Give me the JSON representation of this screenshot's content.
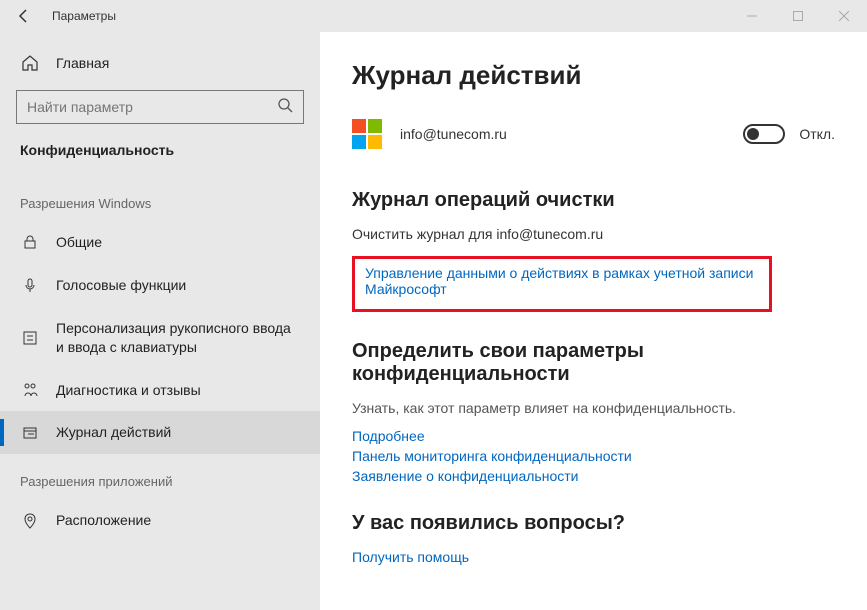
{
  "titlebar": {
    "title": "Параметры"
  },
  "sidebar": {
    "home": "Главная",
    "search_placeholder": "Найти параметр",
    "category": "Конфиденциальность",
    "group1": "Разрешения Windows",
    "items1": [
      {
        "label": "Общие"
      },
      {
        "label": "Голосовые функции"
      },
      {
        "label": "Персонализация рукописного ввода и ввода с клавиатуры"
      },
      {
        "label": "Диагностика и отзывы"
      },
      {
        "label": "Журнал действий"
      }
    ],
    "group2": "Разрешения приложений",
    "items2": [
      {
        "label": "Расположение"
      }
    ]
  },
  "main": {
    "title": "Журнал действий",
    "email": "info@tunecom.ru",
    "toggle_label": "Откл.",
    "section_clear": "Журнал операций очистки",
    "clear_desc": "Очистить журнал для info@tunecom.ru",
    "manage_link": "Управление данными о действиях в рамках учетной записи Майкрософт",
    "section_privacy": "Определить свои параметры конфиденциальности",
    "privacy_desc": "Узнать, как этот параметр влияет на конфиденциальность.",
    "link_more": "Подробнее",
    "link_dashboard": "Панель мониторинга конфиденциальности",
    "link_statement": "Заявление о конфиденциальности",
    "section_questions": "У вас появились вопросы?",
    "link_help": "Получить помощь"
  }
}
